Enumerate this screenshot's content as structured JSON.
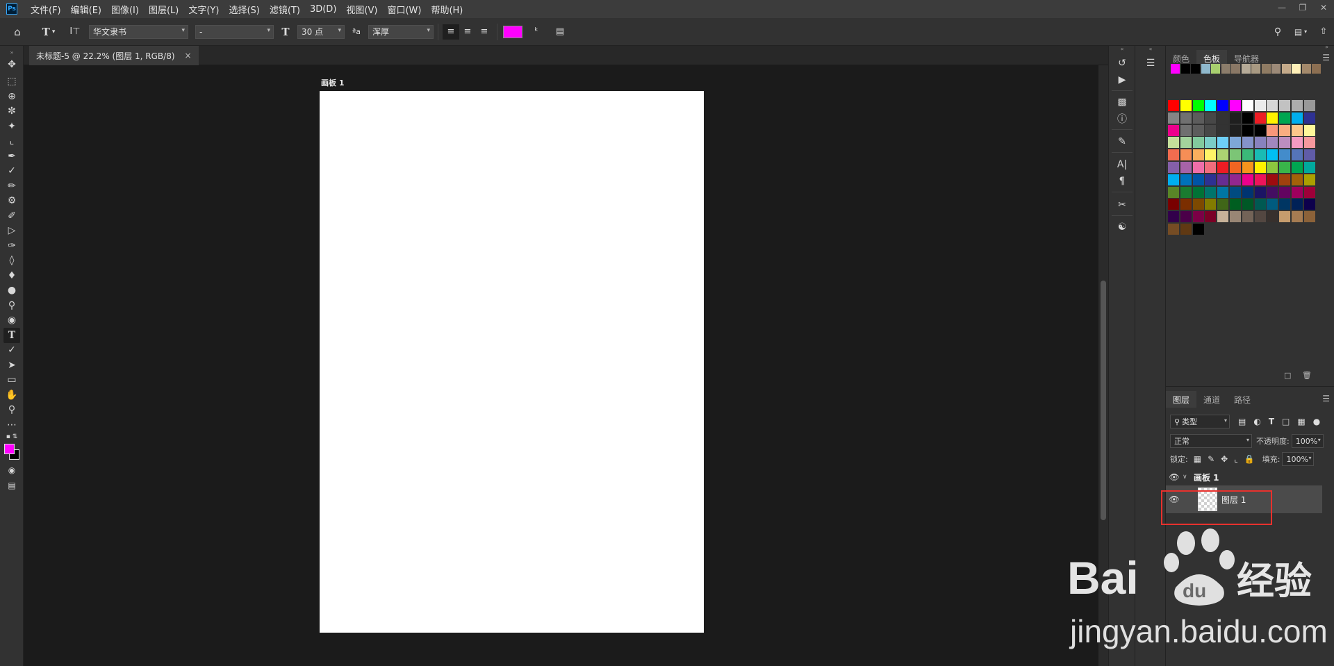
{
  "menubar": {
    "logo": "Ps",
    "items": [
      "文件(F)",
      "编辑(E)",
      "图像(I)",
      "图层(L)",
      "文字(Y)",
      "选择(S)",
      "滤镜(T)",
      "3D(D)",
      "视图(V)",
      "窗口(W)",
      "帮助(H)"
    ]
  },
  "options": {
    "font_family": "华文隶书",
    "font_style": "-",
    "font_size": "30 点",
    "aa_label": "ªa",
    "antialias": "浑厚",
    "text_color": "#ff00ff"
  },
  "document": {
    "tab_title": "未标题-5 @ 22.2% (图层 1, RGB/8)",
    "artboard_name": "画板 1"
  },
  "swatches_panel": {
    "tabs": [
      "颜色",
      "色板",
      "导航器"
    ],
    "active_tab": "色板",
    "recent": [
      "#ff00ff",
      "#000000",
      "#000000",
      "#8fb8cc",
      "#a8cf6e",
      "#8c7d6b",
      "#8a7866",
      "#b5aa97",
      "#a89982",
      "#8f7b63",
      "#9c8a78",
      "#c4aa8a",
      "#fff0b8",
      "#a3896b",
      "#8c6f52"
    ],
    "grid": [
      "#ff0000",
      "#ffff00",
      "#00ff00",
      "#00ffff",
      "#0000ff",
      "#ff00ff",
      "#ffffff",
      "#ebebeb",
      "#d6d6d6",
      "#c2c2c2",
      "#adadad",
      "#999999",
      "#858585",
      "#707070",
      "#5c5c5c",
      "#474747",
      "#333333",
      "#1f1f1f",
      "#000000",
      "#ed1c24",
      "#fff200",
      "#00a651",
      "#00aeef",
      "#2e3192",
      "#ec008c",
      "#707070",
      "#5c5c5c",
      "#474747",
      "#333333",
      "#1f1f1f",
      "#000000",
      "#000000",
      "#f7977a",
      "#f9ad81",
      "#fdc68a",
      "#fff79a",
      "#c4df9b",
      "#a3d39c",
      "#82ca9d",
      "#7bcdc8",
      "#6ecff6",
      "#7ea7d8",
      "#8493ca",
      "#8882be",
      "#a187be",
      "#bc8dbf",
      "#f49ac2",
      "#f6989d",
      "#f26c4f",
      "#f68e56",
      "#fbaf5d",
      "#fff467",
      "#acd372",
      "#7cc576",
      "#3bb878",
      "#1abbb4",
      "#00bff3",
      "#438ccb",
      "#5574b9",
      "#605ca8",
      "#855fa8",
      "#a763a8",
      "#f06ea9",
      "#f26d7d",
      "#ed1c24",
      "#f26522",
      "#f7941d",
      "#fff200",
      "#8dc73f",
      "#39b54a",
      "#00a651",
      "#00a99d",
      "#00aeef",
      "#0072bc",
      "#0054a6",
      "#2e3192",
      "#662d91",
      "#92278f",
      "#ec008c",
      "#ed145b",
      "#9e0b0f",
      "#a0410d",
      "#a36209",
      "#aba000",
      "#598527",
      "#1a7b30",
      "#007236",
      "#00746b",
      "#0076a3",
      "#004b80",
      "#003471",
      "#1b1464",
      "#440e62",
      "#630460",
      "#9e005d",
      "#9e0039",
      "#790000",
      "#7b2e00",
      "#7d4900",
      "#827b00",
      "#406618",
      "#005e20",
      "#005826",
      "#005952",
      "#005b7f",
      "#003663",
      "#002157",
      "#0d004c",
      "#32004b",
      "#4b0049",
      "#7b0046",
      "#7a0026",
      "#c7b299",
      "#998675",
      "#736357",
      "#534741",
      "#37302d",
      "#c69c6d",
      "#a67c52",
      "#8c6239",
      "#754c24",
      "#603913",
      "#000000"
    ]
  },
  "layers_panel": {
    "tabs": [
      "图层",
      "通道",
      "路径"
    ],
    "active_tab": "图层",
    "filter_label": "类型",
    "blend_mode": "正常",
    "opacity_label": "不透明度:",
    "opacity_value": "100%",
    "lock_label": "锁定:",
    "fill_label": "填充:",
    "fill_value": "100%",
    "layers": [
      {
        "name": "画板 1",
        "type": "artboard"
      },
      {
        "name": "图层 1",
        "type": "layer"
      }
    ]
  },
  "watermark": {
    "brand": "Bai",
    "du": "du",
    "suffix": "经验",
    "url": "jingyan.baidu.com"
  }
}
